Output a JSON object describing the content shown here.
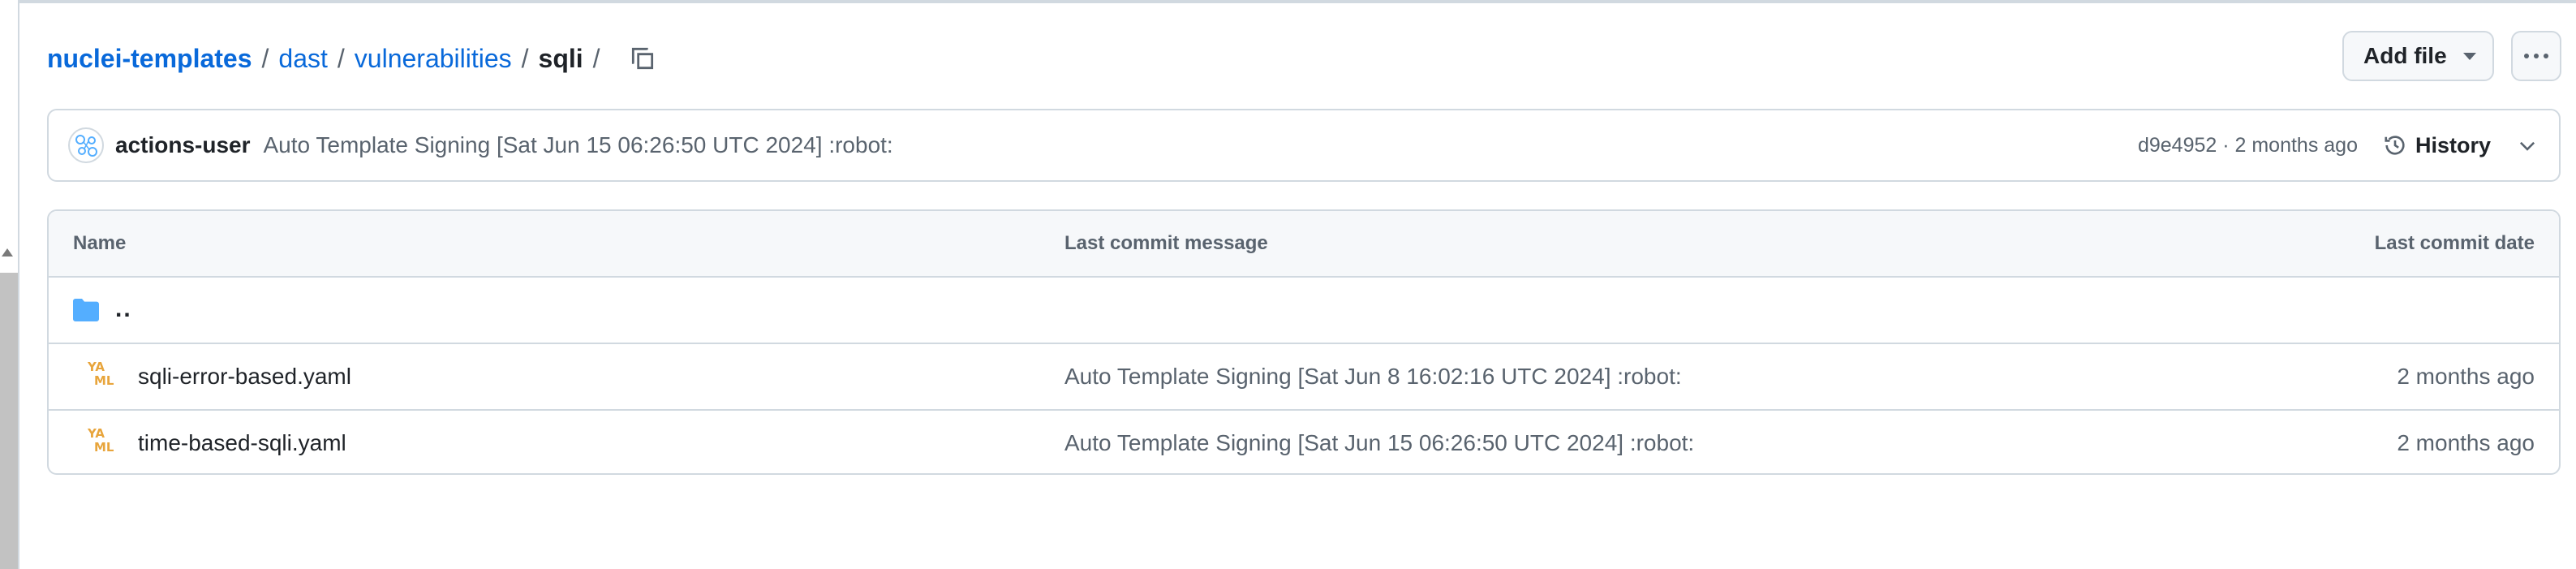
{
  "breadcrumb": {
    "repo": "nuclei-templates",
    "segments": [
      "dast",
      "vulnerabilities"
    ],
    "current": "sqli",
    "separator": "/"
  },
  "buttons": {
    "add_file": "Add file"
  },
  "commit": {
    "user": "actions-user",
    "message": "Auto Template Signing [Sat Jun 15 06:26:50 UTC 2024] :robot:",
    "meta": "d9e4952 · 2 months ago",
    "history_label": "History"
  },
  "table": {
    "headers": [
      "Name",
      "Last commit message",
      "Last commit date"
    ],
    "parent": "..",
    "rows": [
      {
        "name": "sqli-error-based.yaml",
        "message": "Auto Template Signing [Sat Jun 8 16:02:16 UTC 2024] :robot:",
        "date": "2 months ago"
      },
      {
        "name": "time-based-sqli.yaml",
        "message": "Auto Template Signing [Sat Jun 15 06:26:50 UTC 2024] :robot:",
        "date": "2 months ago"
      }
    ]
  },
  "icons": {
    "yaml_top": "YA",
    "yaml_bottom": "ML"
  },
  "colors": {
    "link": "#0969da",
    "muted": "#59636e",
    "border": "#d1d9e0",
    "folder": "#54aeff",
    "yaml": "#e8a53c"
  }
}
